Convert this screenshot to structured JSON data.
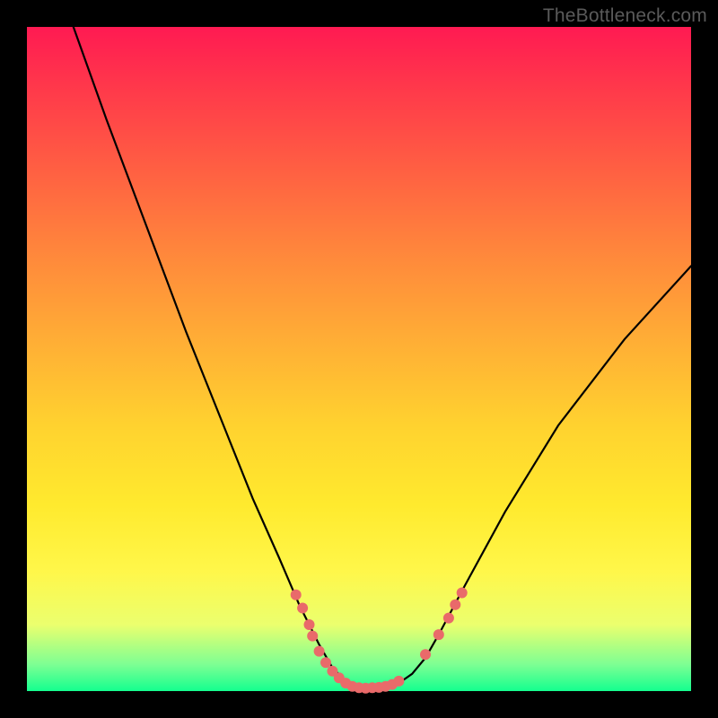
{
  "watermark": "TheBottleneck.com",
  "chart_data": {
    "type": "line",
    "title": "",
    "xlabel": "",
    "ylabel": "",
    "xlim": [
      0,
      100
    ],
    "ylim": [
      0,
      100
    ],
    "series": [
      {
        "name": "curve",
        "x": [
          7,
          12,
          18,
          24,
          30,
          34,
          38,
          41,
          44,
          46,
          48,
          50,
          52,
          54,
          56,
          58,
          60,
          62,
          66,
          72,
          80,
          90,
          100
        ],
        "values": [
          100,
          86,
          70,
          54,
          39,
          29,
          20,
          13,
          7,
          3.5,
          1.5,
          0.5,
          0.4,
          0.6,
          1.2,
          2.6,
          5,
          8.5,
          16,
          27,
          40,
          53,
          64
        ]
      }
    ],
    "markers": [
      {
        "x": 40.5,
        "y": 14.5
      },
      {
        "x": 41.5,
        "y": 12.5
      },
      {
        "x": 42.5,
        "y": 10.0
      },
      {
        "x": 43.0,
        "y": 8.3
      },
      {
        "x": 44.0,
        "y": 6.0
      },
      {
        "x": 45.0,
        "y": 4.3
      },
      {
        "x": 46.0,
        "y": 3.0
      },
      {
        "x": 47.0,
        "y": 2.0
      },
      {
        "x": 48.0,
        "y": 1.2
      },
      {
        "x": 49.0,
        "y": 0.7
      },
      {
        "x": 50.0,
        "y": 0.5
      },
      {
        "x": 51.0,
        "y": 0.45
      },
      {
        "x": 52.0,
        "y": 0.5
      },
      {
        "x": 53.0,
        "y": 0.55
      },
      {
        "x": 54.0,
        "y": 0.7
      },
      {
        "x": 55.0,
        "y": 1.0
      },
      {
        "x": 56.0,
        "y": 1.5
      },
      {
        "x": 60.0,
        "y": 5.5
      },
      {
        "x": 62.0,
        "y": 8.5
      },
      {
        "x": 63.5,
        "y": 11.0
      },
      {
        "x": 64.5,
        "y": 13.0
      },
      {
        "x": 65.5,
        "y": 14.8
      }
    ],
    "marker_color": "#e96a6a",
    "curve_color": "#000000"
  }
}
